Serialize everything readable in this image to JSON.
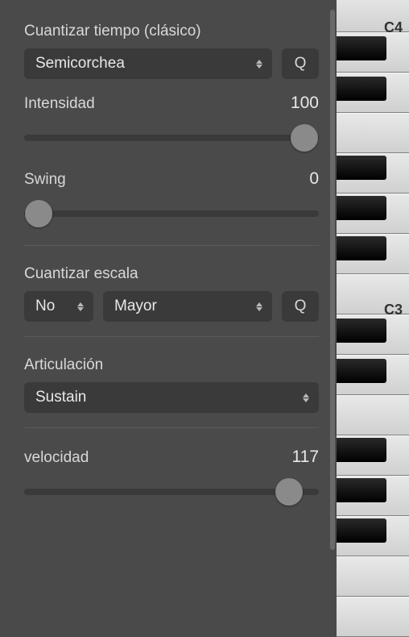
{
  "quantize_time": {
    "label": "Cuantizar tiempo (clásico)",
    "value": "Semicorchea",
    "q_button": "Q"
  },
  "intensity": {
    "label": "Intensidad",
    "value": "100",
    "percent": 100
  },
  "swing": {
    "label": "Swing",
    "value": "0",
    "percent": 0
  },
  "quantize_scale": {
    "label": "Cuantizar escala",
    "enabled_value": "No",
    "mode_value": "Mayor",
    "q_button": "Q"
  },
  "articulation": {
    "label": "Articulación",
    "value": "Sustain"
  },
  "velocity": {
    "label": "velocidad",
    "value": "117",
    "percent": 92
  },
  "piano": {
    "c4_label": "C4",
    "c3_label": "C3"
  }
}
